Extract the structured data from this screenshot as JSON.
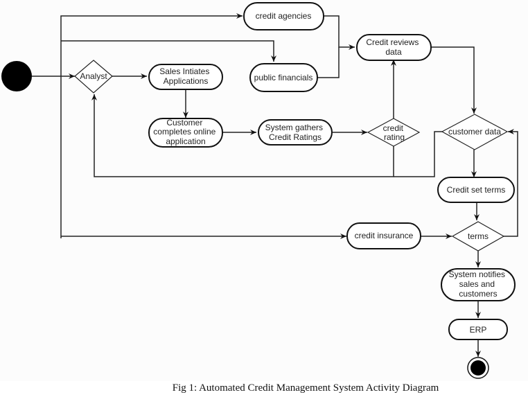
{
  "diagram": {
    "type": "activity",
    "nodes": {
      "start": {
        "kind": "initial"
      },
      "analyst": {
        "kind": "decision",
        "label": "Analyst"
      },
      "sales": {
        "kind": "action",
        "label": [
          "Sales Intiates",
          "Applications"
        ]
      },
      "customer_app": {
        "kind": "action",
        "label": [
          "Customer",
          "completes online",
          "application"
        ]
      },
      "system_gathers": {
        "kind": "action",
        "label": [
          "System gathers",
          "Credit Ratings"
        ]
      },
      "credit_rating": {
        "kind": "decision",
        "label": [
          "credit",
          "rating"
        ]
      },
      "credit_agencies": {
        "kind": "action",
        "label": [
          "credit agencies"
        ]
      },
      "public_financials": {
        "kind": "action",
        "label": [
          "public financials"
        ]
      },
      "credit_reviews": {
        "kind": "action",
        "label": [
          "Credit reviews",
          "data"
        ]
      },
      "customer_data": {
        "kind": "decision",
        "label": "customer data"
      },
      "credit_set_terms": {
        "kind": "action",
        "label": [
          "Credit set terms"
        ]
      },
      "credit_insurance": {
        "kind": "action",
        "label": [
          "credit insurance"
        ]
      },
      "terms": {
        "kind": "decision",
        "label": "terms"
      },
      "system_notifies": {
        "kind": "action",
        "label": [
          "System notifies",
          "sales and",
          "customers"
        ]
      },
      "erp": {
        "kind": "action",
        "label": [
          "ERP"
        ]
      },
      "end": {
        "kind": "final"
      }
    },
    "edges": [
      [
        "start",
        "analyst"
      ],
      [
        "start",
        "credit_agencies"
      ],
      [
        "start",
        "public_financials"
      ],
      [
        "start",
        "credit_insurance"
      ],
      [
        "analyst",
        "sales"
      ],
      [
        "sales",
        "customer_app"
      ],
      [
        "customer_app",
        "system_gathers"
      ],
      [
        "system_gathers",
        "credit_rating"
      ],
      [
        "credit_rating",
        "credit_reviews"
      ],
      [
        "credit_rating",
        "analyst"
      ],
      [
        "customer_data",
        "analyst"
      ],
      [
        "credit_agencies",
        "credit_reviews"
      ],
      [
        "public_financials",
        "credit_reviews"
      ],
      [
        "credit_reviews",
        "customer_data"
      ],
      [
        "customer_data",
        "credit_set_terms"
      ],
      [
        "credit_set_terms",
        "terms"
      ],
      [
        "credit_insurance",
        "terms"
      ],
      [
        "terms",
        "customer_data"
      ],
      [
        "terms",
        "system_notifies"
      ],
      [
        "system_notifies",
        "erp"
      ],
      [
        "erp",
        "end"
      ]
    ]
  },
  "caption": "Fig 1: Automated Credit Management System Activity Diagram"
}
